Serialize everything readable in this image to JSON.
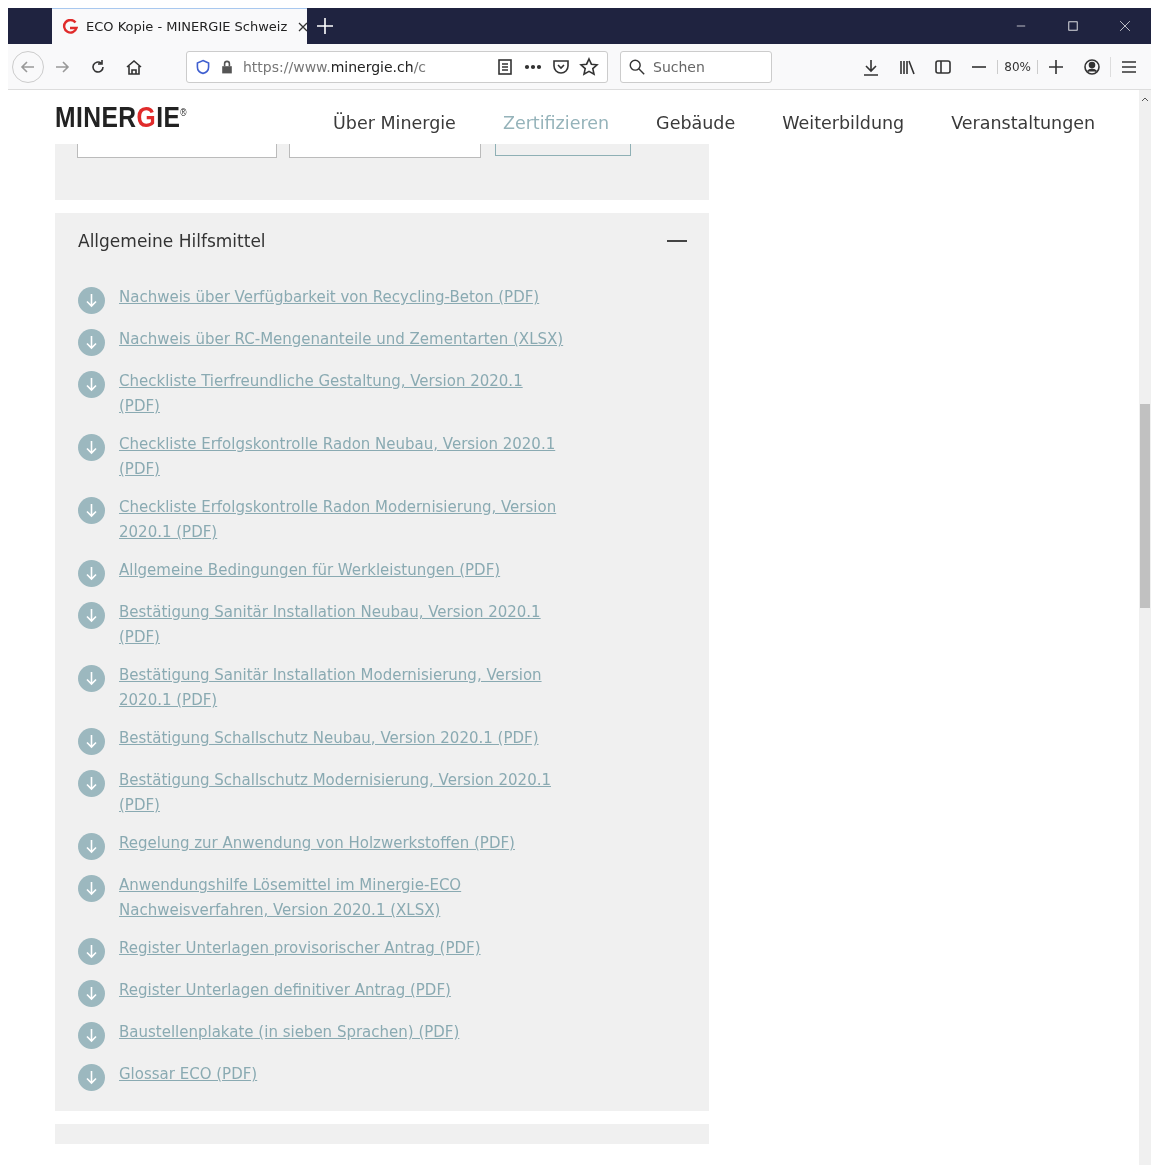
{
  "browser": {
    "tab_title": "ECO Kopie - MINERGIE Schweiz",
    "url_prefix": "https://www.",
    "url_domain": "minergie.ch",
    "url_rest": "/c",
    "search": {
      "placeholder": "Suchen"
    },
    "zoom": "80%"
  },
  "site": {
    "logo_left": "MINER",
    "logo_g": "G",
    "logo_right": "IE",
    "logo_mark": "®",
    "nav": [
      {
        "label": "Über Minergie",
        "selected": false
      },
      {
        "label": "Zertifizieren",
        "selected": true
      },
      {
        "label": "Gebäude",
        "selected": false
      },
      {
        "label": "Weiterbildung",
        "selected": false
      },
      {
        "label": "Veranstaltungen",
        "selected": false
      }
    ]
  },
  "section": {
    "title": "Allgemeine Hilfsmittel",
    "expanded": true,
    "links": [
      "Nachweis über Verfügbarkeit von Recycling-Beton (PDF)",
      "Nachweis über RC-Mengenanteile und Zementarten (XLSX)",
      "Checkliste Tierfreundliche Gestaltung, Version 2020.1 (PDF)",
      "Checkliste Erfolgskontrolle Radon Neubau, Version 2020.1 (PDF)",
      "Checkliste Erfolgskontrolle Radon Modernisierung, Version 2020.1 (PDF)",
      "Allgemeine Bedingungen für Werkleistungen (PDF)",
      "Bestätigung Sanitär Installation Neubau, Version 2020.1 (PDF)",
      "Bestätigung Sanitär Installation Modernisierung, Version 2020.1 (PDF)",
      "Bestätigung Schallschutz Neubau, Version 2020.1 (PDF)",
      "Bestätigung Schallschutz Modernisierung, Version 2020.1 (PDF)",
      "Regelung zur Anwendung von Holzwerkstoffen (PDF)",
      "Anwendungshilfe Lösemittel im Minergie-ECO Nachweisverfahren, Version 2020.1 (XLSX)",
      "Register Unterlagen provisorischer Antrag (PDF)",
      "Register Unterlagen definitiver Antrag (PDF)",
      "Baustellenplakate (in sieben Sprachen) (PDF)",
      "Glossar ECO (PDF)"
    ]
  }
}
